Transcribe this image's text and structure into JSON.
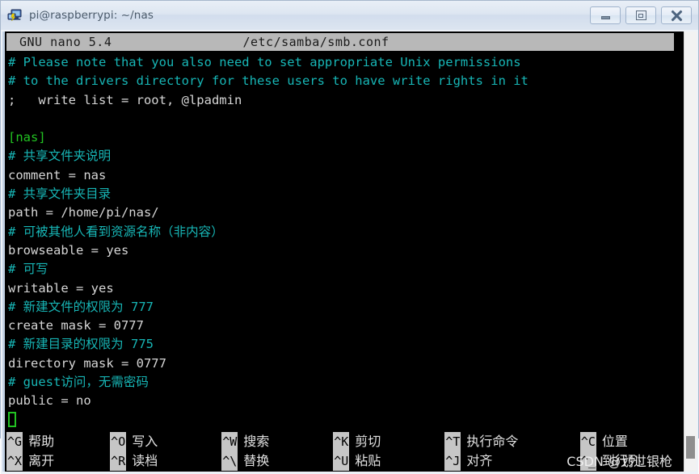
{
  "window": {
    "title": "pi@raspberrypi: ~/nas",
    "icon": "putty-computer-icon",
    "buttons": {
      "minimize": "minimize",
      "maximize": "maximize",
      "close": "close"
    }
  },
  "nano": {
    "version": "GNU nano 5.4",
    "filename": "/etc/samba/smb.conf",
    "lines": [
      {
        "text": "# Please note that you also need to set appropriate Unix permissions",
        "type": "comment"
      },
      {
        "text": "# to the drivers directory for these users to have write rights in it",
        "type": "comment"
      },
      {
        "text": ";   write list = root, @lpadmin",
        "type": "plain"
      },
      {
        "text": "",
        "type": "plain"
      },
      {
        "text": "[nas]",
        "type": "section"
      },
      {
        "text": "# 共享文件夹说明",
        "type": "comment"
      },
      {
        "text": "comment = nas",
        "type": "plain"
      },
      {
        "text": "# 共享文件夹目录",
        "type": "comment"
      },
      {
        "text": "path = /home/pi/nas/",
        "type": "plain"
      },
      {
        "text": "# 可被其他人看到资源名称（非内容）",
        "type": "comment"
      },
      {
        "text": "browseable = yes",
        "type": "plain"
      },
      {
        "text": "# 可写",
        "type": "comment"
      },
      {
        "text": "writable = yes",
        "type": "plain"
      },
      {
        "text": "# 新建文件的权限为 777",
        "type": "comment"
      },
      {
        "text": "create mask = 0777",
        "type": "plain"
      },
      {
        "text": "# 新建目录的权限为 775",
        "type": "comment"
      },
      {
        "text": "directory mask = 0777",
        "type": "plain"
      },
      {
        "text": "# guest访问，无需密码",
        "type": "comment"
      },
      {
        "text": "public = no",
        "type": "plain"
      }
    ]
  },
  "shortcuts": [
    {
      "key_top": "^G",
      "label_top": "帮助",
      "key_bottom": "^X",
      "label_bottom": "离开"
    },
    {
      "key_top": "^O",
      "label_top": "写入",
      "key_bottom": "^R",
      "label_bottom": "读档"
    },
    {
      "key_top": "^W",
      "label_top": "搜索",
      "key_bottom": "^\\",
      "label_bottom": "替换"
    },
    {
      "key_top": "^K",
      "label_top": "剪切",
      "key_bottom": "^U",
      "label_bottom": "粘贴"
    },
    {
      "key_top": "^T",
      "label_top": "执行命令",
      "key_bottom": "^J",
      "label_bottom": "对齐"
    },
    {
      "key_top": "^C",
      "label_top": "位置",
      "key_bottom": "^_",
      "label_bottom": "到行列"
    }
  ],
  "watermark": "CSDN @划过银枪",
  "colors": {
    "terminal_bg": "#000000",
    "comment": "#17b6b6",
    "section": "#22c322",
    "plain_text": "#d6d6d6",
    "nano_header_bg": "#b8b8b8",
    "cursor": "#22c322",
    "titlebar": "#dde6f1"
  }
}
